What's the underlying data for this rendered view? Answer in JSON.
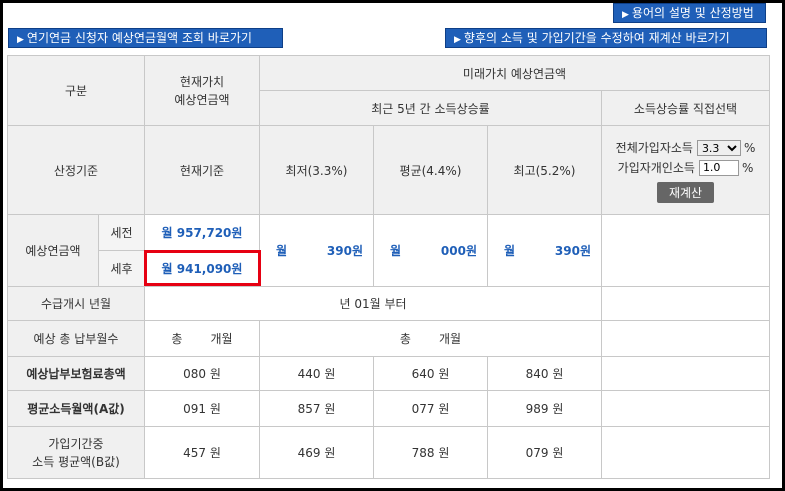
{
  "buttons": {
    "guide": "용어의 설명 및 산정방법",
    "inquiry": "연기연금 신청자 예상연금월액 조회 바로가기",
    "recalc_link": "향후의 소득 및 가입기간을 수정하여 재계산 바로가기"
  },
  "header": {
    "category": "구분",
    "present_value": "현재가치\n예상연금액",
    "future_value": "미래가치 예상연금액",
    "recent_rate": "최근 5년 간 소득상승률",
    "direct_rate": "소득상승률 직접선택"
  },
  "basis": {
    "label": "산정기준",
    "present": "현재기준",
    "low": "최저(3.3%)",
    "avg": "평균(4.4%)",
    "high": "최고(5.2%)"
  },
  "controls": {
    "total_income_label": "전체가입자소득",
    "total_income_value": "3.3",
    "personal_income_label": "가입자개인소득",
    "personal_income_value": "1.0",
    "percent": "%",
    "recalc_button": "재계산"
  },
  "pension": {
    "label": "예상연금액",
    "pretax_label": "세전",
    "aftertax_label": "세후",
    "pretax_value": "월 957,720원",
    "aftertax_value": "월 941,090원",
    "low": {
      "prefix": "월",
      "value": "390원"
    },
    "avg": {
      "prefix": "월",
      "value": "000원"
    },
    "high": {
      "prefix": "월",
      "value": "390원"
    }
  },
  "start": {
    "label": "수급개시 년월",
    "value": "년 01월 부터"
  },
  "months": {
    "label": "예상 총 납부월수",
    "present_total": "총",
    "present_unit": "개월",
    "future_total": "총",
    "future_unit": "개월"
  },
  "premium": {
    "label": "예상납부보험료총액",
    "present": "080 원",
    "low": "440 원",
    "avg": "640 원",
    "high": "840 원"
  },
  "avg_income_a": {
    "label": "평균소득월액(A값)",
    "present": "091 원",
    "low": "857 원",
    "avg": "077 원",
    "high": "989 원"
  },
  "avg_income_b": {
    "label": "가입기간중\n소득 평균액(B값)",
    "present": "457 원",
    "low": "469 원",
    "avg": "788 원",
    "high": "079 원"
  }
}
